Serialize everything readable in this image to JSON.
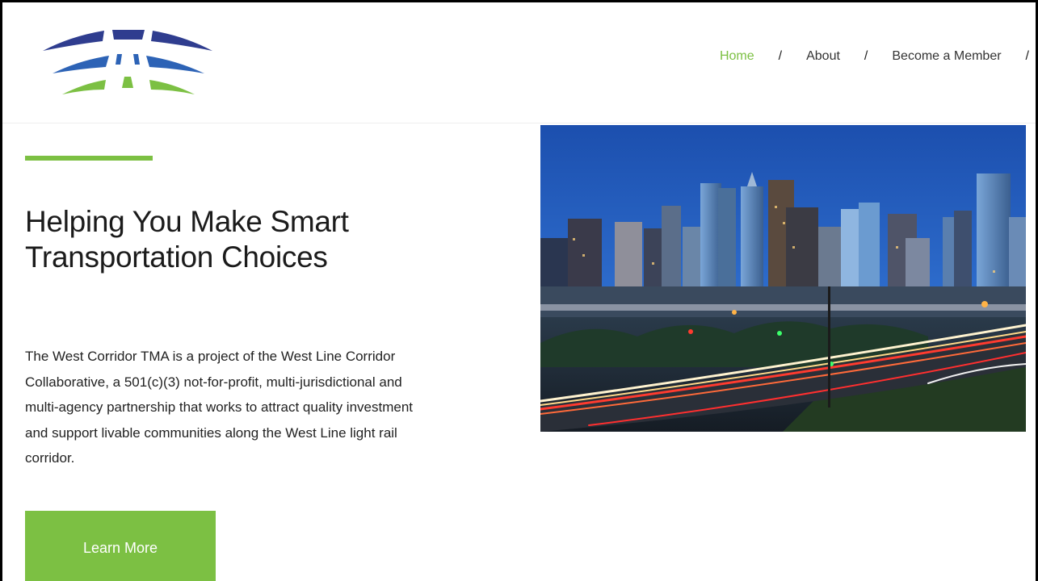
{
  "brand": {
    "colors": {
      "navy": "#2f3d8f",
      "blue": "#2d63b6",
      "green": "#7cc043"
    }
  },
  "nav": {
    "items": [
      {
        "label": "Home",
        "active": true
      },
      {
        "label": "About",
        "active": false
      },
      {
        "label": "Become a Member",
        "active": false
      }
    ],
    "separator": "/"
  },
  "hero": {
    "title_line1": "Helping You Make Smart",
    "title_line2": "Transportation Choices",
    "body": "The West Corridor TMA is a project of the West Line Corridor Collaborative, a 501(c)(3) not-for-profit, multi-jurisdictional and multi-agency partnership that works to attract quality investment and support livable communities along the West Line light rail corridor.",
    "cta_label": "Learn More"
  }
}
